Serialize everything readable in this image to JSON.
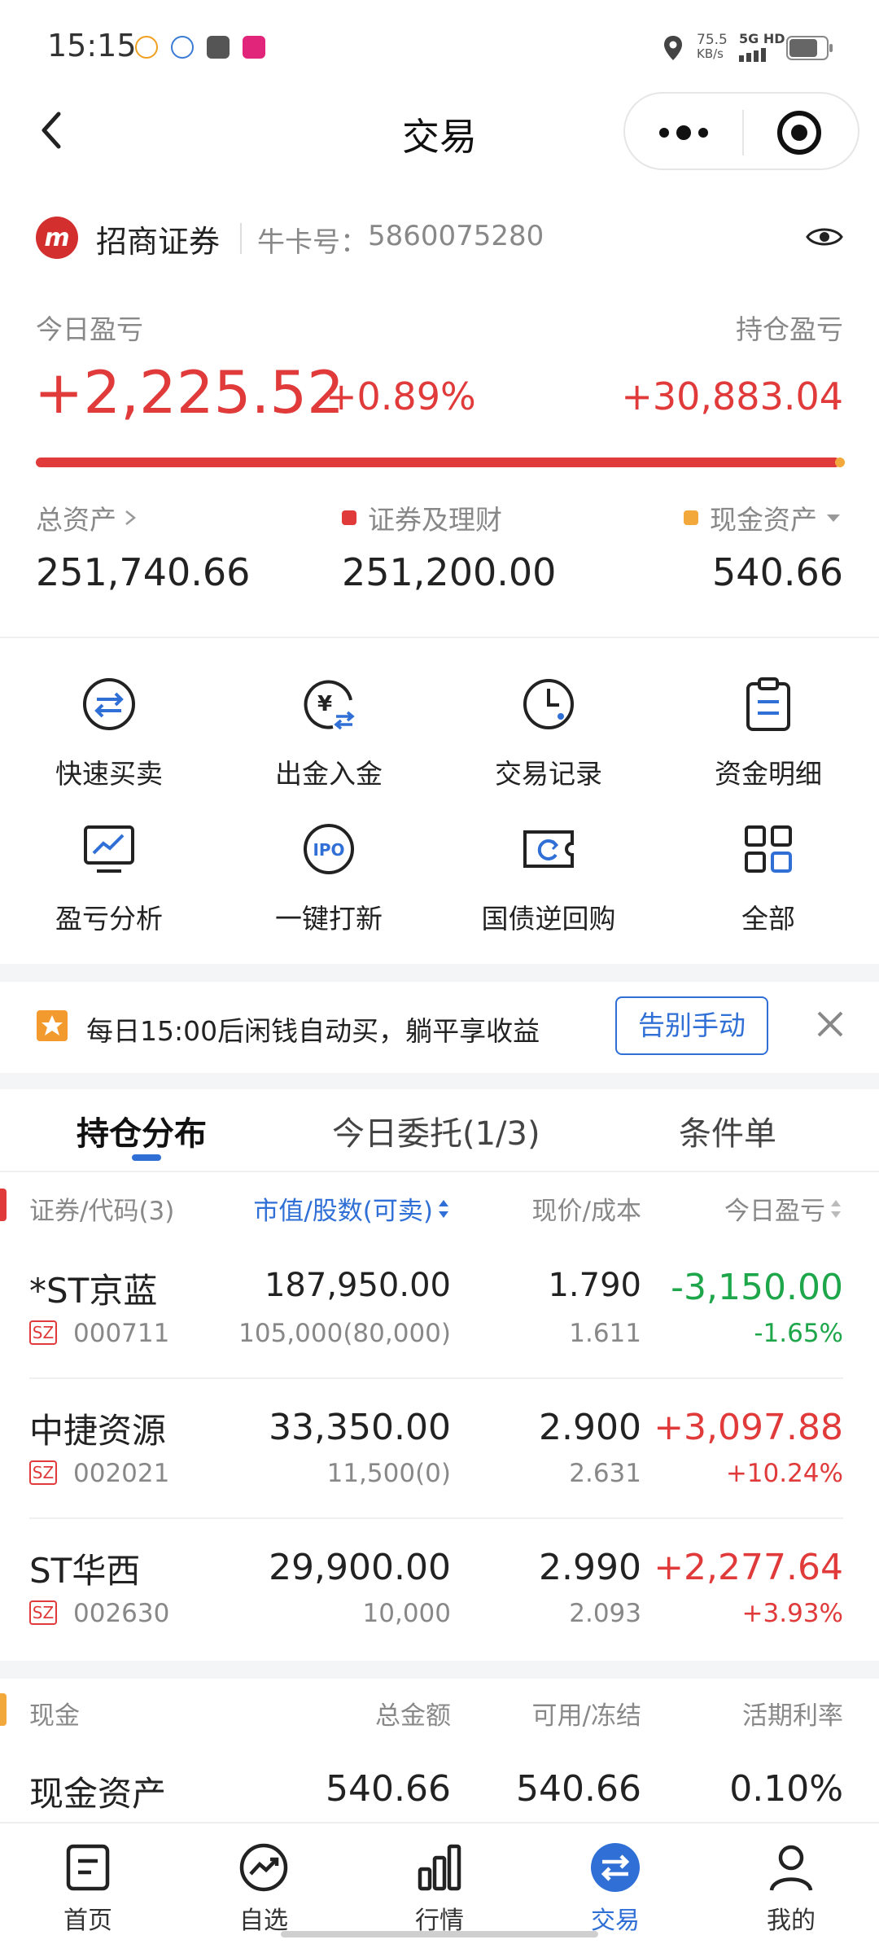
{
  "status_bar": {
    "time": "15:15",
    "net_speed_value": "75.5",
    "net_speed_unit": "KB/s",
    "network": "5G HD",
    "app_badges": [
      "qq-app-icon",
      "browser-app-icon",
      "vivo-app-icon",
      "news-app-icon"
    ]
  },
  "header": {
    "title": "交易",
    "back_icon": "chevron-left-icon",
    "more_icon": "more-dots-icon",
    "target_icon": "record-target-icon"
  },
  "account": {
    "broker": "招商证券",
    "card_label": "牛卡号：",
    "card_no": "5860075280",
    "eye_icon": "eye-icon"
  },
  "pnl": {
    "today_label": "今日盈亏",
    "today_value": "+2,225.52",
    "today_pct": "+0.89%",
    "holding_label": "持仓盈亏",
    "holding_value": "+30,883.04"
  },
  "assets": {
    "total_label": "总资产",
    "total_value": "251,740.66",
    "securities_label": "证券及理财",
    "securities_value": "251,200.00",
    "cash_label": "现金资产",
    "cash_value": "540.66",
    "securities_fraction": 0.9979
  },
  "grid_menu": [
    {
      "label": "快速买卖",
      "icon": "swap-circle-icon"
    },
    {
      "label": "出金入金",
      "icon": "yuan-transfer-icon"
    },
    {
      "label": "交易记录",
      "icon": "clock-icon"
    },
    {
      "label": "资金明细",
      "icon": "clipboard-icon"
    },
    {
      "label": "盈亏分析",
      "icon": "monitor-chart-icon"
    },
    {
      "label": "一键打新",
      "icon": "ipo-icon"
    },
    {
      "label": "国债逆回购",
      "icon": "ticket-refresh-icon"
    },
    {
      "label": "全部",
      "icon": "grid-apps-icon"
    }
  ],
  "promo": {
    "text": "每日15:00后闲钱自动买，躺平享收益",
    "button": "告别手动",
    "icon": "star-icon",
    "close_icon": "close-icon"
  },
  "tabs": [
    "持仓分布",
    "今日委托(1/3)",
    "条件单"
  ],
  "table": {
    "headers": {
      "name": "证券/代码(3)",
      "value": "市值/股数(可卖)",
      "price": "现价/成本",
      "today": "今日盈亏"
    },
    "rows": [
      {
        "name": "*ST京蓝",
        "market": "SZ",
        "code": "000711",
        "market_value": "187,950.00",
        "shares": "105,000(80,000)",
        "price": "1.790",
        "cost": "1.611",
        "pnl": "-3,150.00",
        "pnl_pct": "-1.65%",
        "trend": "down"
      },
      {
        "name": "中捷资源",
        "market": "SZ",
        "code": "002021",
        "market_value": "33,350.00",
        "shares": "11,500(0)",
        "price": "2.900",
        "cost": "2.631",
        "pnl": "+3,097.88",
        "pnl_pct": "+10.24%",
        "trend": "up"
      },
      {
        "name": "ST华西",
        "market": "SZ",
        "code": "002630",
        "market_value": "29,900.00",
        "shares": "10,000",
        "price": "2.990",
        "cost": "2.093",
        "pnl": "+2,277.64",
        "pnl_pct": "+3.93%",
        "trend": "up"
      }
    ]
  },
  "cash": {
    "header": {
      "name": "现金",
      "total": "总金额",
      "avail": "可用/冻结",
      "rate": "活期利率"
    },
    "row": {
      "name": "现金资产",
      "total": "540.66",
      "avail": "540.66",
      "rate": "0.10%"
    }
  },
  "bottom_nav": [
    {
      "label": "首页",
      "icon": "home-doc-icon",
      "active": false
    },
    {
      "label": "自选",
      "icon": "trend-circle-icon",
      "active": false
    },
    {
      "label": "行情",
      "icon": "bar-chart-icon",
      "active": false
    },
    {
      "label": "交易",
      "icon": "swap-circle-filled-icon",
      "active": true
    },
    {
      "label": "我的",
      "icon": "person-icon",
      "active": false
    }
  ],
  "colors": {
    "up": "#e03a3a",
    "down": "#1ea64a",
    "accent": "#2f6fd6",
    "cash": "#f2a83a"
  }
}
